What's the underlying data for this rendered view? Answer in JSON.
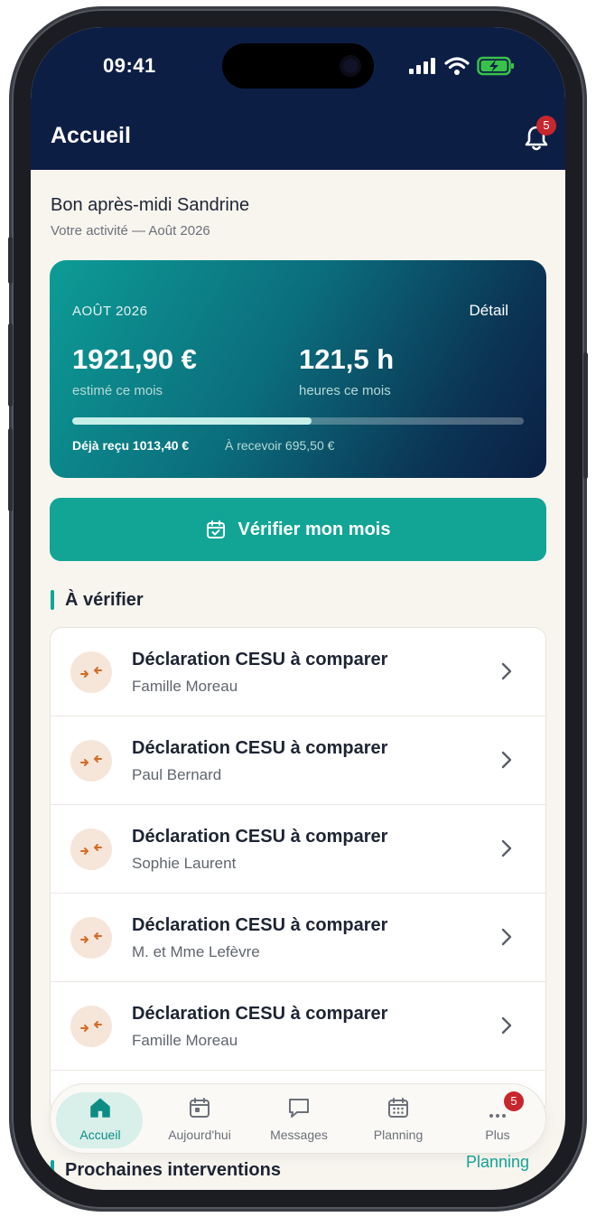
{
  "status": {
    "time": "09:41"
  },
  "header": {
    "title": "Accueil",
    "notifications": "5"
  },
  "greeting": {
    "title": "Bon après-midi Sandrine",
    "subtitle": "Votre activité — Août 2026"
  },
  "summary": {
    "month": "AOÛT 2026",
    "detail": "Détail",
    "amount": "1921,90 €",
    "amount_label": "estimé ce mois",
    "hours": "121,5 h",
    "hours_label": "heures ce mois",
    "progress_fraction": 0.53,
    "received": "Déjà reçu 1013,40 €",
    "to_receive": "À recevoir 695,50 €"
  },
  "verify_button": "Vérifier mon mois",
  "to_check": {
    "title": "À vérifier",
    "items": [
      {
        "title": "Déclaration CESU à comparer",
        "subtitle": "Famille Moreau"
      },
      {
        "title": "Déclaration CESU à comparer",
        "subtitle": "Paul Bernard"
      },
      {
        "title": "Déclaration CESU à comparer",
        "subtitle": "Sophie Laurent"
      },
      {
        "title": "Déclaration CESU à comparer",
        "subtitle": "M. et Mme Lefèvre"
      },
      {
        "title": "Déclaration CESU à comparer",
        "subtitle": "Famille Moreau"
      }
    ]
  },
  "next": {
    "title": "Prochaines interventions",
    "link": "Planning"
  },
  "tabs": [
    {
      "label": "Accueil"
    },
    {
      "label": "Aujourd'hui"
    },
    {
      "label": "Messages"
    },
    {
      "label": "Planning"
    },
    {
      "label": "Plus",
      "badge": "5"
    }
  ],
  "colors": {
    "navy": "#0d1e45",
    "teal": "#12a596",
    "badge": "#c8262e",
    "background": "#f8f5ef"
  }
}
